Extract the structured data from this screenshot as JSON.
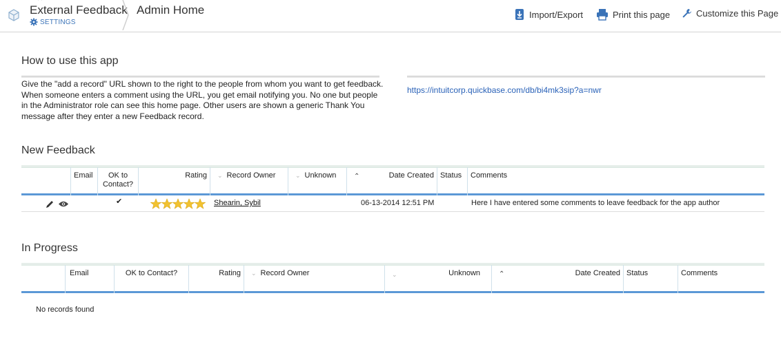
{
  "header": {
    "app_title": "External Feedback",
    "settings_label": "SETTINGS",
    "page_name": "Admin Home",
    "actions": {
      "import_export": "Import/Export",
      "print": "Print this page",
      "customize": "Customize this Page"
    }
  },
  "how_to": {
    "title": "How to use this app",
    "body": "Give the \"add a record\" URL shown to the right to the people from whom you want to get feedback. When someone enters a comment using the URL, you get email notifying you. No one but people in the Administrator role can see this home page. Other users are shown a generic Thank You message after they enter a new Feedback record.",
    "url": "https://intuitcorp.quickbase.com/db/bi4mk3sip?a=nwr"
  },
  "new_feedback": {
    "title": "New Feedback",
    "columns": {
      "email": "Email",
      "ok_to_contact": "OK to Contact?",
      "rating": "Rating",
      "record_owner": "Record Owner",
      "unknown": "Unknown",
      "date_created": "Date Created",
      "status": "Status",
      "comments": "Comments"
    },
    "rows": [
      {
        "ok_to_contact": "✔",
        "rating": 5,
        "record_owner": "Shearin, Sybil",
        "date_created": "06-13-2014 12:51 PM",
        "comments": "Here I have entered some comments to leave feedback for the app author"
      }
    ]
  },
  "in_progress": {
    "title": "In Progress",
    "columns": {
      "email": "Email",
      "ok_to_contact": "OK to Contact?",
      "rating": "Rating",
      "record_owner": "Record Owner",
      "unknown": "Unknown",
      "date_created": "Date Created",
      "status": "Status",
      "comments": "Comments"
    },
    "empty_text": "No records found"
  },
  "colors": {
    "accent_blue": "#5b98d6",
    "link_blue": "#2a62b8",
    "star_gold": "#f2c230"
  }
}
